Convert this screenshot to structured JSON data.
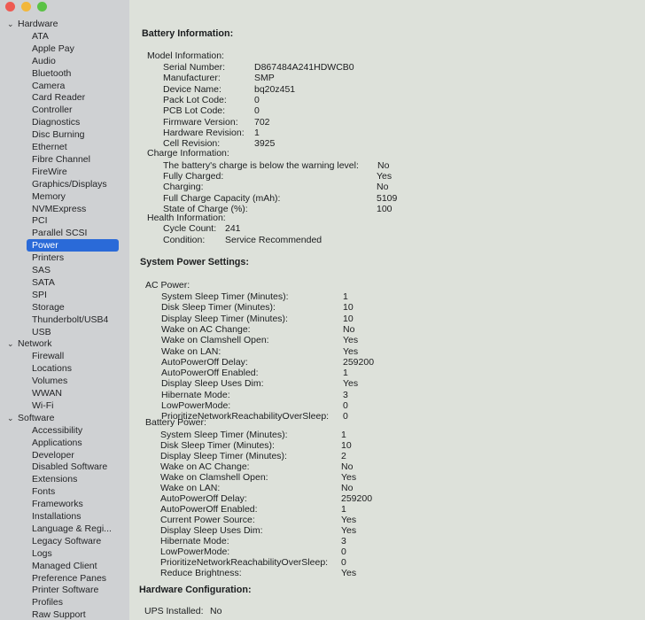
{
  "sidebar": {
    "groups": [
      {
        "label": "Hardware",
        "items": [
          "ATA",
          "Apple Pay",
          "Audio",
          "Bluetooth",
          "Camera",
          "Card Reader",
          "Controller",
          "Diagnostics",
          "Disc Burning",
          "Ethernet",
          "Fibre Channel",
          "FireWire",
          "Graphics/Displays",
          "Memory",
          "NVMExpress",
          "PCI",
          "Parallel SCSI",
          "Power",
          "Printers",
          "SAS",
          "SATA",
          "SPI",
          "Storage",
          "Thunderbolt/USB4",
          "USB"
        ]
      },
      {
        "label": "Network",
        "items": [
          "Firewall",
          "Locations",
          "Volumes",
          "WWAN",
          "Wi-Fi"
        ]
      },
      {
        "label": "Software",
        "items": [
          "Accessibility",
          "Applications",
          "Developer",
          "Disabled Software",
          "Extensions",
          "Fonts",
          "Frameworks",
          "Installations",
          "Language & Regi...",
          "Legacy Software",
          "Logs",
          "Managed Client",
          "Preference Panes",
          "Printer Software",
          "Profiles",
          "Raw Support"
        ]
      }
    ],
    "selected": "Power"
  },
  "battery": {
    "title": "Battery Information:",
    "model_header": "Model Information:",
    "model": [
      {
        "label": "Serial Number:",
        "value": "D867484A241HDWCB0"
      },
      {
        "label": "Manufacturer:",
        "value": "SMP"
      },
      {
        "label": "Device Name:",
        "value": "bq20z451"
      },
      {
        "label": "Pack Lot Code:",
        "value": "0"
      },
      {
        "label": "PCB Lot Code:",
        "value": "0"
      },
      {
        "label": "Firmware Version:",
        "value": "702"
      },
      {
        "label": "Hardware Revision:",
        "value": "1"
      },
      {
        "label": "Cell Revision:",
        "value": "3925"
      }
    ],
    "charge_header": "Charge Information:",
    "charge": [
      {
        "label": "The battery's charge is below the warning level:",
        "value": "No"
      },
      {
        "label": "Fully Charged:",
        "value": "Yes"
      },
      {
        "label": "Charging:",
        "value": "No"
      },
      {
        "label": "Full Charge Capacity (mAh):",
        "value": "5109"
      },
      {
        "label": "State of Charge (%):",
        "value": "100"
      }
    ],
    "health_header": "Health Information:",
    "health": [
      {
        "label": "Cycle Count:",
        "value": "241"
      },
      {
        "label": "Condition:",
        "value": "Service Recommended"
      }
    ]
  },
  "power": {
    "title": "System Power Settings:",
    "ac_header": "AC Power:",
    "ac": [
      {
        "label": "System Sleep Timer (Minutes):",
        "value": "1"
      },
      {
        "label": "Disk Sleep Timer (Minutes):",
        "value": "10"
      },
      {
        "label": "Display Sleep Timer (Minutes):",
        "value": "10"
      },
      {
        "label": "Wake on AC Change:",
        "value": "No"
      },
      {
        "label": "Wake on Clamshell Open:",
        "value": "Yes"
      },
      {
        "label": "Wake on LAN:",
        "value": "Yes"
      },
      {
        "label": "AutoPowerOff Delay:",
        "value": "259200"
      },
      {
        "label": "AutoPowerOff Enabled:",
        "value": "1"
      },
      {
        "label": "Display Sleep Uses Dim:",
        "value": "Yes"
      },
      {
        "label": "Hibernate Mode:",
        "value": "3"
      },
      {
        "label": "LowPowerMode:",
        "value": "0"
      },
      {
        "label": "PrioritizeNetworkReachabilityOverSleep:",
        "value": "0"
      }
    ],
    "battery_header": "Battery Power:",
    "battery": [
      {
        "label": "System Sleep Timer (Minutes):",
        "value": "1"
      },
      {
        "label": "Disk Sleep Timer (Minutes):",
        "value": "10"
      },
      {
        "label": "Display Sleep Timer (Minutes):",
        "value": "2"
      },
      {
        "label": "Wake on AC Change:",
        "value": "No"
      },
      {
        "label": "Wake on Clamshell Open:",
        "value": "Yes"
      },
      {
        "label": "Wake on LAN:",
        "value": "No"
      },
      {
        "label": "AutoPowerOff Delay:",
        "value": "259200"
      },
      {
        "label": "AutoPowerOff Enabled:",
        "value": "1"
      },
      {
        "label": "Current Power Source:",
        "value": "Yes"
      },
      {
        "label": "Display Sleep Uses Dim:",
        "value": "Yes"
      },
      {
        "label": "Hibernate Mode:",
        "value": "3"
      },
      {
        "label": "LowPowerMode:",
        "value": "0"
      },
      {
        "label": "PrioritizeNetworkReachabilityOverSleep:",
        "value": "0"
      },
      {
        "label": "Reduce Brightness:",
        "value": "Yes"
      }
    ]
  },
  "hardware_config": {
    "title": "Hardware Configuration:",
    "ups_label": "UPS Installed:",
    "ups_value": "No"
  }
}
